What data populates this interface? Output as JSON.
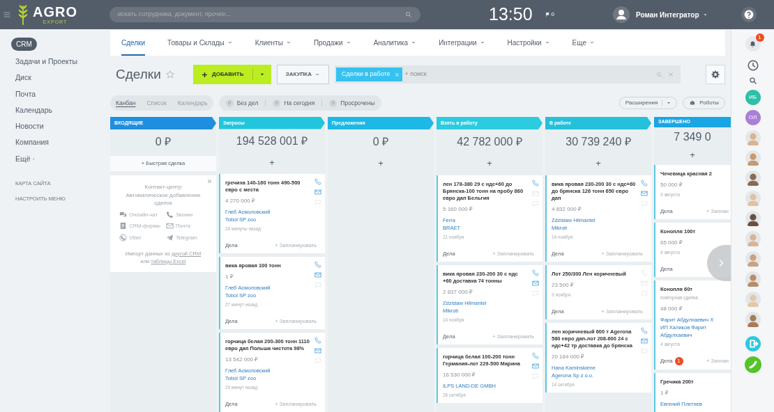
{
  "header": {
    "logo": {
      "name": "AGRO",
      "tagline": "EXPORT"
    },
    "search": {
      "placeholder": "искать сотрудника, документ, прочее..."
    },
    "clock": "13:50",
    "flag_count": "0",
    "user": "Роман Интегратор"
  },
  "sidebar": {
    "items": [
      {
        "label": "CRM",
        "selected": true
      },
      {
        "label": "Задачи и Проекты",
        "selected": false
      },
      {
        "label": "Диск",
        "selected": false
      },
      {
        "label": "Почта",
        "selected": false
      },
      {
        "label": "Календарь",
        "selected": false
      },
      {
        "label": "Новости",
        "selected": false
      },
      {
        "label": "Компания",
        "selected": false
      },
      {
        "label": "Ещё ·",
        "selected": false
      }
    ],
    "links": [
      "КАРТА САЙТА",
      "НАСТРОИТЬ МЕНЮ"
    ]
  },
  "tabs": [
    {
      "label": "Сделки",
      "selected": true,
      "dropdown": false
    },
    {
      "label": "Товары и Склады",
      "selected": false,
      "dropdown": true
    },
    {
      "label": "Клиенты",
      "selected": false,
      "dropdown": true
    },
    {
      "label": "Продажи",
      "selected": false,
      "dropdown": true
    },
    {
      "label": "Аналитика",
      "selected": false,
      "dropdown": true
    },
    {
      "label": "Интеграции",
      "selected": false,
      "dropdown": true
    },
    {
      "label": "Настройки",
      "selected": false,
      "dropdown": true
    },
    {
      "label": "Еще",
      "selected": false,
      "dropdown": true
    }
  ],
  "toolbar": {
    "title": "Сделки",
    "add_button": "ДОБАВИТЬ",
    "category_button": "ЗАКУПКА",
    "filter": {
      "tag": "Сделки в работе",
      "placeholder": "+ поиск"
    }
  },
  "views": [
    {
      "label": "Канбан",
      "selected": true
    },
    {
      "label": "Список",
      "selected": false
    },
    {
      "label": "Календарь",
      "selected": false
    }
  ],
  "counters": [
    {
      "count": "0",
      "label": "Без дел"
    },
    {
      "count": "0",
      "label": "На сегодня"
    },
    {
      "count": "0",
      "label": "Просрочены"
    }
  ],
  "extensions_button": "Расширения",
  "robots_button": "Роботы",
  "columns": [
    {
      "title": "ВХОДЯЩИЕ",
      "color": "#1e8fe0",
      "total": "0 ₽",
      "add": "+ Быстрая сделка",
      "widget": {
        "title": "Контакт-центр",
        "subtitle": "Автоматическое добавление сделок",
        "channels": [
          {
            "kind": "chat",
            "label": "Онлайн-чат"
          },
          {
            "kind": "call",
            "label": "Звонки"
          },
          {
            "kind": "form",
            "label": "CRM-формы"
          },
          {
            "kind": "mail",
            "label": "Почта"
          },
          {
            "kind": "viber",
            "label": "Viber"
          },
          {
            "kind": "telegram",
            "label": "Telegram"
          }
        ],
        "import": [
          {
            "text": "Импорт данных из",
            "link": false
          },
          {
            "text": "другой CRM",
            "link": true
          },
          {
            "text": "или",
            "link": false
          },
          {
            "text": "таблицы Excel",
            "link": true
          }
        ]
      }
    },
    {
      "title": "Запросы",
      "color": "#22c6dc",
      "total": "194 528 001 ₽",
      "add": "+",
      "cards": [
        {
          "title": "гречиха 140-160 тонн 490-500 евро с места",
          "amount": "4 270 000 ₽",
          "contacts": [
            "Глеб Асмоловский",
            "Tobol SP zoo"
          ],
          "date": "24 минуты назад",
          "actions": "Дела",
          "schedule": "+ Запланировать",
          "phone": true,
          "mail": true,
          "chat": false
        },
        {
          "title": "вика яровая 100 тонн",
          "amount": "1 ₽",
          "contacts": [
            "Глеб Асмоловский",
            "Tobol SP zoo"
          ],
          "date": "27 минут назад",
          "actions": "Дела",
          "schedule": "+ Запланировать",
          "phone": true,
          "mail": true,
          "chat": false
        },
        {
          "title": "горчица белая 200-300 тонн 1110 евро дап Польша чистота 98%",
          "amount": "13 542 000 ₽",
          "contacts": [
            "Глеб Асмоловский",
            "Tobol SP zoo"
          ],
          "date": "29 минут назад",
          "actions": "Дела",
          "schedule": "+ Запланировать",
          "phone": true,
          "mail": true,
          "chat": false
        }
      ]
    },
    {
      "title": "Предложения",
      "color": "#1cb8e6",
      "total": "0 ₽",
      "add": "+"
    },
    {
      "title": "Взять в работу",
      "color": "#2bcbe0",
      "total": "42 782 000 ₽",
      "add": "+",
      "cards": [
        {
          "title": "лен 178-380 29 с ндс+60 до Брянска-100 тонн на пробу 860 евро дап Бельгия",
          "amount": "5 160 000 ₽",
          "contacts": [
            "Ferra",
            "BRAET"
          ],
          "date": "21 ноября",
          "actions": "Дела",
          "schedule": "+ Запланировать",
          "phone": true,
          "mail": false,
          "chat": false
        },
        {
          "title": "вика яровая 230-200 30 с ндс +60 доставка 74 тонны",
          "amount": "2 837 000 ₽",
          "contacts": [
            "Zdzislaw Hilmantel",
            "Mikrob"
          ],
          "date": "14 ноября",
          "actions": "Дела",
          "schedule": "+ Запланировать",
          "phone": true,
          "mail": true,
          "chat": false
        },
        {
          "title": "горчица белая 100-200 тонн Германия-лот 229-500 Марина",
          "amount": "16 530 000 ₽",
          "contacts": [
            "ILPS LAND-DE GMBH"
          ],
          "date": "26 октября",
          "phone": true,
          "mail": true,
          "chat": false
        }
      ]
    },
    {
      "title": "В работе",
      "color": "#25c0da",
      "total": "30 739 240 ₽",
      "add": "+",
      "cards": [
        {
          "title": "вика яровая 230-200 30 с ндс+60 до брянска 126 тонн 650 евро дап",
          "amount": "4 832 000 ₽",
          "contacts": [
            "Zdzislaw Hilmantel",
            "Mikrob"
          ],
          "date": "14 ноября",
          "actions": "Дела",
          "schedule": "+ Запланировать",
          "phone": true,
          "mail": true,
          "chat": false
        },
        {
          "title": "Лот 250/300 Лен коричневый",
          "amount": "23 500 ₽",
          "date": "9 ноября",
          "actions": "Дела",
          "schedule": "+ Запланировать",
          "phone": false,
          "mail": false,
          "chat": false
        },
        {
          "title": "лен коричневый 600 т Agerona 580 евро дап-лот 208-600 24 с ндс+42 тр доставка до брянска",
          "amount": "20 184 000 ₽",
          "contacts": [
            "Hana Kaminskiene",
            "Agerona Sp z o.o."
          ],
          "date": "14 октября",
          "phone": true,
          "mail": true,
          "chat": false
        }
      ]
    },
    {
      "title": "ЗАВЕРШЕНО",
      "color": "#1aa5e4",
      "total": "7 349 0",
      "add": "+",
      "cards": [
        {
          "title": "Чечевица красная 2",
          "amount": "50 000 ₽",
          "date": "9 августа",
          "actions": "Дела",
          "schedule": "+ Заплан"
        },
        {
          "title": "Конопля 100т",
          "amount": "65 000 ₽",
          "date": "4 августа",
          "actions": "Дела"
        },
        {
          "title": "Конопля 60т",
          "note": "повторная сделка",
          "amount": "48 000 ₽",
          "contacts": [
            "Фарит Абдулхаевич Х",
            "ИП Халиков Фарит Абдулхаевич"
          ],
          "date": "4 августа",
          "actions": "Дела",
          "badge": "1",
          "schedule": "+ Заплан"
        },
        {
          "title": "Гречика 200т",
          "amount": "1 ₽",
          "contacts": [
            "Евгений Плетнев"
          ]
        }
      ]
    }
  ],
  "right_rail": {
    "notifications_badge": "1",
    "people": [
      {
        "kind": "initials",
        "initials": "ИБ",
        "color": "#2ebfa8"
      },
      {
        "kind": "initials",
        "initials": "ОЛ",
        "color": "#a97fd8"
      },
      {
        "kind": "photo"
      },
      {
        "kind": "photo"
      },
      {
        "kind": "photo"
      },
      {
        "kind": "photo"
      },
      {
        "kind": "photo"
      },
      {
        "kind": "photo"
      },
      {
        "kind": "photo"
      },
      {
        "kind": "photo"
      },
      {
        "kind": "photo"
      },
      {
        "kind": "photo"
      }
    ]
  }
}
